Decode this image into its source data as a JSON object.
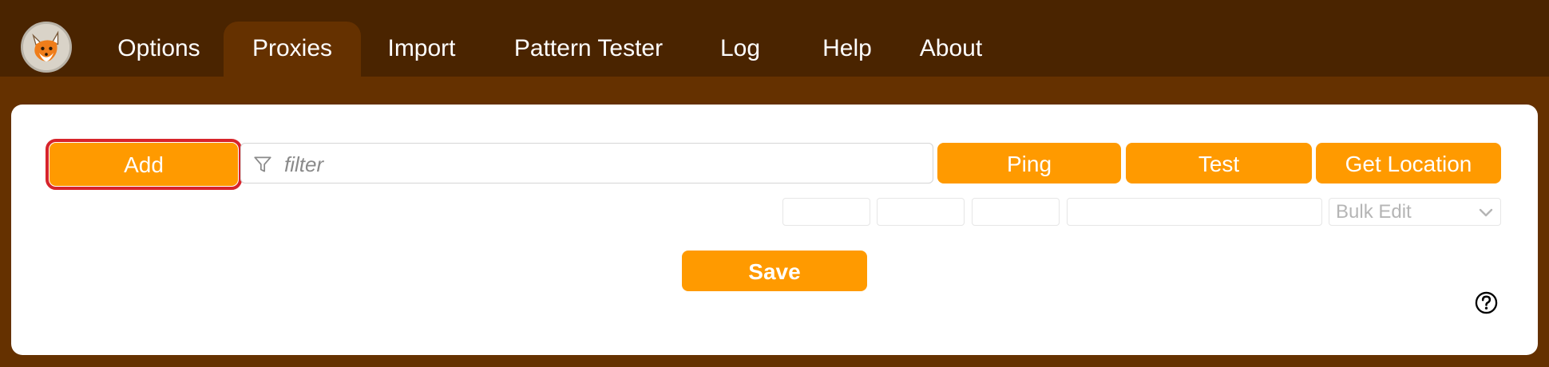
{
  "header": {
    "tabs": [
      {
        "label": "Options",
        "active": false
      },
      {
        "label": "Proxies",
        "active": true
      },
      {
        "label": "Import",
        "active": false
      },
      {
        "label": "Pattern Tester",
        "active": false
      },
      {
        "label": "Log",
        "active": false
      },
      {
        "label": "Help",
        "active": false
      },
      {
        "label": "About",
        "active": false
      }
    ]
  },
  "toolbar": {
    "add_label": "Add",
    "filter_placeholder": "filter",
    "ping_label": "Ping",
    "test_label": "Test",
    "get_location_label": "Get Location",
    "bulk_edit_selected": "Bulk Edit"
  },
  "footer": {
    "save_label": "Save"
  },
  "colors": {
    "accent": "#ff9a00",
    "header_bg": "#4a2400",
    "page_bg": "#653100",
    "highlight_outline": "#d7242b"
  },
  "icons": {
    "logo": "foxyproxy-fox-logo",
    "filter": "funnel-icon",
    "dropdown": "chevron-down-icon",
    "help": "question-circle-icon"
  }
}
